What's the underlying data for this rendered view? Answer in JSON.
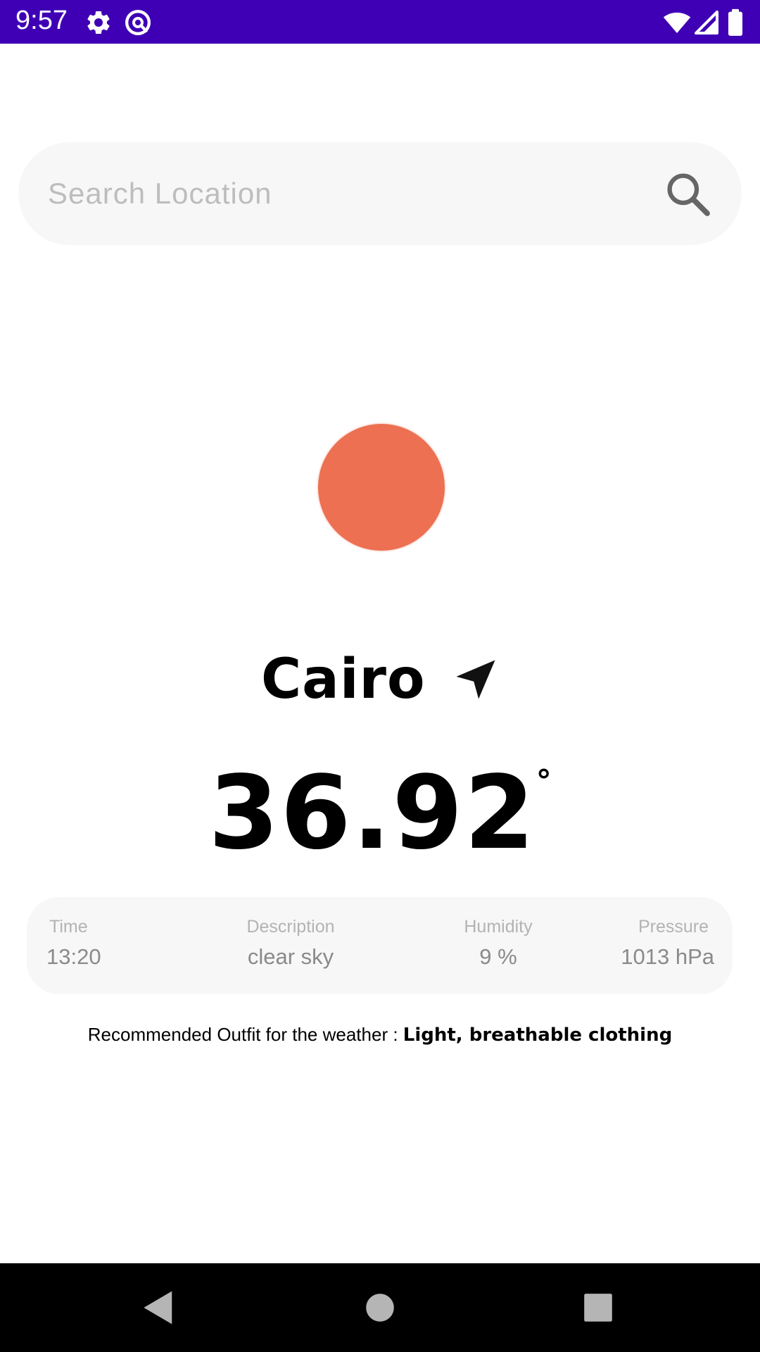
{
  "status_bar": {
    "time": "9:57",
    "bg_color": "#3f00b5",
    "icons": [
      "settings-icon",
      "at-sign-icon",
      "wifi-icon",
      "signal-icon",
      "battery-icon"
    ]
  },
  "search": {
    "placeholder": "Search Location",
    "value": "",
    "icon": "search-icon"
  },
  "weather": {
    "icon": "sun-icon",
    "sun_color": "#ec7051",
    "city": "Cairo",
    "location_icon": "navigation-arrow-icon",
    "temperature": "36.92",
    "degree_symbol": "°"
  },
  "details": [
    {
      "label": "Time",
      "value": "13:20"
    },
    {
      "label": "Description",
      "value": "clear sky"
    },
    {
      "label": "Humidity",
      "value": "9 %"
    },
    {
      "label": "Pressure",
      "value": "1013 hPa"
    }
  ],
  "recommendation": {
    "prefix": "Recommended Outfit for the weather : ",
    "outfit": "Light, breathable clothing"
  },
  "nav_bar": {
    "buttons": [
      "back-icon",
      "home-icon",
      "recents-icon"
    ]
  }
}
